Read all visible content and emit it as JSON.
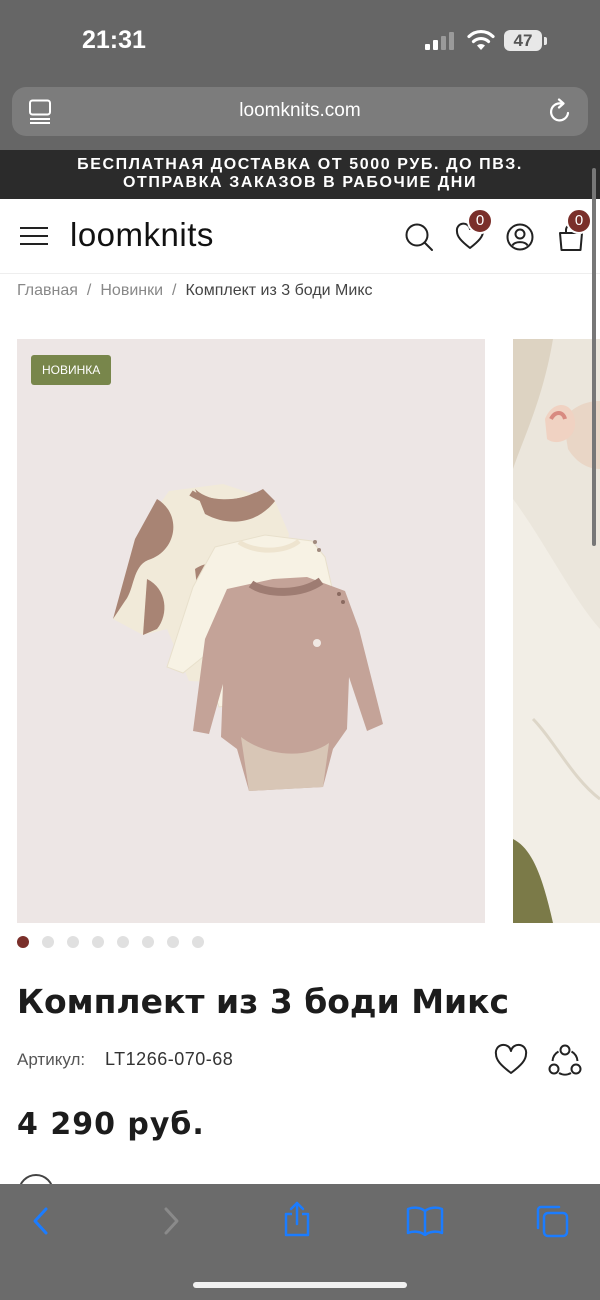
{
  "status_bar": {
    "time": "21:31",
    "battery": "47"
  },
  "browser": {
    "url": "loomknits.com"
  },
  "promo": {
    "line1": "БЕСПЛАТНАЯ ДОСТАВКА ОТ 5000 РУБ. ДО ПВЗ.",
    "line2": "ОТПРАВКА ЗАКАЗОВ В РАБОЧИЕ ДНИ"
  },
  "header": {
    "logo": "loomknits",
    "wishlist_count": "0",
    "cart_count": "0"
  },
  "breadcrumb": {
    "items": [
      "Главная",
      "Новинки"
    ],
    "current": "Комплект из 3 боди Микс",
    "separator": "/"
  },
  "gallery": {
    "badge": "НОВИНКА",
    "total_images": 8,
    "active_index": 0
  },
  "product": {
    "title": "Комплект из 3 боди Микс",
    "sku_label": "Артикул:",
    "sku": "LT1266-070-68",
    "price": "4 290 руб."
  },
  "colors": {
    "accent": "#7a2f2a",
    "new_badge": "#78864b",
    "promo_bg": "#2b2b2b"
  },
  "icons": {
    "menu": "hamburger-icon",
    "search": "search-icon",
    "wishlist": "heart-icon",
    "account": "user-icon",
    "cart": "bag-icon",
    "share": "share-icon"
  }
}
